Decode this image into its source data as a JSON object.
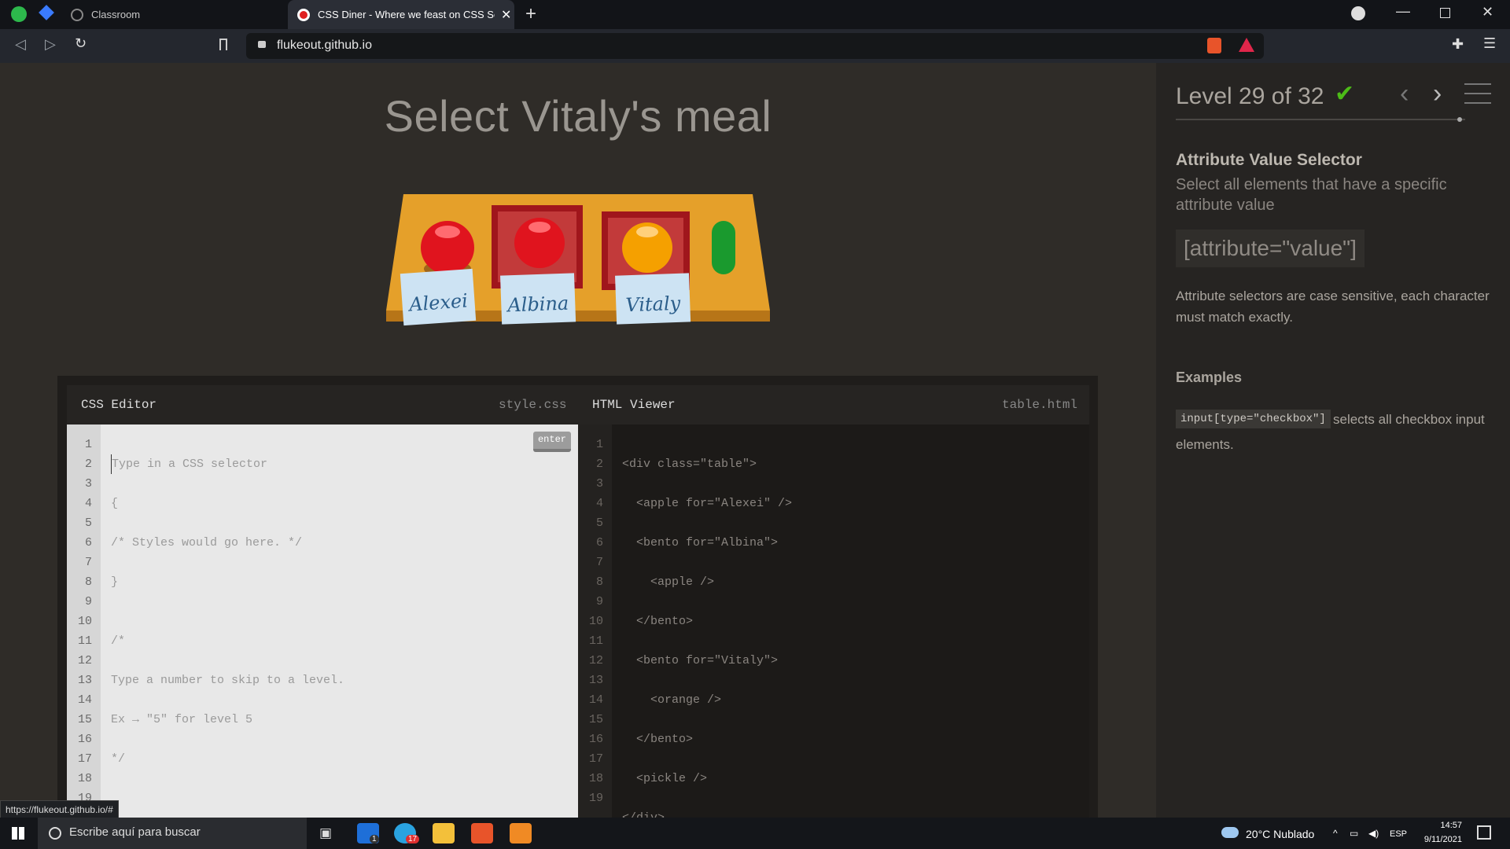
{
  "browser": {
    "tabs": [
      {
        "label": "Classroom",
        "active": false
      },
      {
        "label": "CSS Diner - Where we feast on CSS Sele",
        "active": true
      }
    ],
    "url": "flukeout.github.io",
    "status_url": "https://flukeout.github.io/#"
  },
  "game": {
    "title": "Select Vitaly's meal",
    "name_cards": [
      "Alexei",
      "Albina",
      "Vitaly"
    ]
  },
  "editor": {
    "css_label": "CSS Editor",
    "css_file": "style.css",
    "html_label": "HTML Viewer",
    "html_file": "table.html",
    "enter_label": "enter",
    "css_lines": [
      "Type in a CSS selector",
      "{",
      "/* Styles would go here. */",
      "}",
      "",
      "/*",
      "Type a number to skip to a level.",
      "Ex → \"5\" for level 5",
      "*/"
    ],
    "html_lines": [
      "<div class=\"table\">",
      "  <apple for=\"Alexei\" />",
      "  <bento for=\"Albina\">",
      "    <apple />",
      "  </bento>",
      "  <bento for=\"Vitaly\">",
      "    <orange />",
      "  </bento>",
      "  <pickle />",
      "</div>"
    ]
  },
  "sidebar": {
    "level_title": "Level 29 of 32",
    "level_progress_fraction": 0.98,
    "selector_name": "Attribute Value Selector",
    "selector_desc": "Select all elements that have a specific attribute value",
    "syntax": "[attribute=\"value\"]",
    "hint": "Attribute selectors are case sensitive, each character must match exactly.",
    "examples_title": "Examples",
    "example_code": "input[type=\"checkbox\"]",
    "example_text": "selects all checkbox input elements."
  },
  "taskbar": {
    "search_placeholder": "Escribe aquí para buscar",
    "weather": "20°C  Nublado",
    "lang": "ESP",
    "time": "14:57",
    "date": "9/11/2021",
    "mail_badge": "1",
    "telegram_badge": "17"
  },
  "colors": {
    "page_bg": "#2f2c28",
    "sidebar_bg": "#262422",
    "check_green": "#4cbb17",
    "apple_red": "#e0141e",
    "orange": "#f5a000",
    "pickle_green": "#1a9a2e",
    "table_orange": "#e5a02a"
  }
}
